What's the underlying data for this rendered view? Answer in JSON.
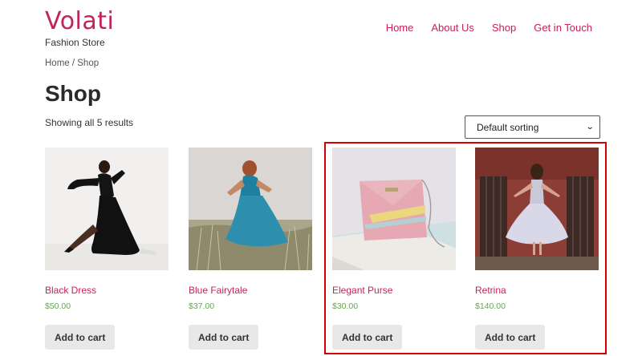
{
  "site": {
    "title": "Volati",
    "tagline": "Fashion Store"
  },
  "nav": {
    "items": [
      {
        "label": "Home"
      },
      {
        "label": "About Us"
      },
      {
        "label": "Shop"
      },
      {
        "label": "Get in Touch"
      }
    ]
  },
  "breadcrumb": "Home / Shop",
  "page_title": "Shop",
  "result_count": "Showing all 5 results",
  "sorting": {
    "selected": "Default sorting"
  },
  "products": [
    {
      "name": "Black Dress",
      "price": "$50.00",
      "button": "Add to cart",
      "image": "black-dress-photo"
    },
    {
      "name": "Blue Fairytale",
      "price": "$37.00",
      "button": "Add to cart",
      "image": "blue-dress-photo"
    },
    {
      "name": "Elegant Purse",
      "price": "$30.00",
      "button": "Add to cart",
      "image": "pink-purse-photo"
    },
    {
      "name": "Retrina",
      "price": "$140.00",
      "button": "Add to cart",
      "image": "white-dress-photo"
    }
  ],
  "colors": {
    "brand": "#c3225d",
    "price": "#6aa454",
    "button_bg": "#e8e8e8",
    "highlight": "#d40000"
  }
}
